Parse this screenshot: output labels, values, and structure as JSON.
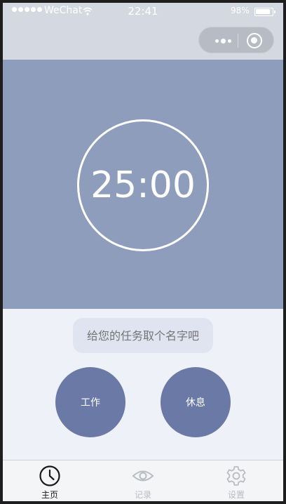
{
  "status_bar": {
    "carrier": "WeChat",
    "time": "22:41",
    "battery": "98%",
    "signal_icon": "signal-dots-icon",
    "wifi_icon": "wifi-icon",
    "battery_icon": "battery-icon"
  },
  "capsule": {
    "more_icon": "more-dots-icon",
    "close_icon": "target-close-icon"
  },
  "timer": {
    "display": "25:00"
  },
  "task": {
    "placeholder": "给您的任务取个名字吧"
  },
  "buttons": {
    "work": "工作",
    "rest": "休息"
  },
  "tabbar": {
    "items": [
      {
        "label": "主页",
        "icon": "clock-icon",
        "active": true
      },
      {
        "label": "记录",
        "icon": "eye-icon",
        "active": false
      },
      {
        "label": "设置",
        "icon": "gear-icon",
        "active": false
      }
    ]
  },
  "colors": {
    "timer_background": "#8f9dbd",
    "button": "#6a79a6",
    "page_background": "#eef1f8",
    "header_background": "#d4d8e1"
  }
}
